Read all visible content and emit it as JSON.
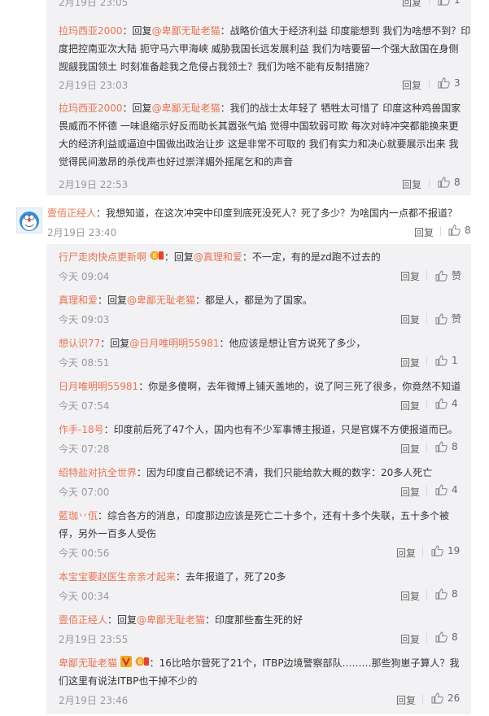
{
  "top_partial": {
    "time": "2月19日 23:05",
    "reply_label": "回复",
    "likes": "1"
  },
  "replies_top": [
    {
      "name": "拉玛西亚2000",
      "prefix": "：回复",
      "at": "@卑鄙无耻老猫",
      "text1": "：战略价值大于经济利益 印度能想到 我们为啥想不到？印",
      "text2": "度把控南亚次大陆 扼守马六甲海峡 威胁我国长远发展利益 我们为啥要留一个强大敌国在身侧",
      "text3": "觊觎我国领土 时刻准备趁我之危侵占我领土？我们为啥不能有反制措施？",
      "time": "2月19日 23:03",
      "reply_label": "回复",
      "likes": "3"
    },
    {
      "name": "拉玛西亚2000",
      "prefix": "：回复",
      "at": "@卑鄙无耻老猫",
      "text1": "：我们的战士太年轻了 牺牲太可惜了 印度这种鸡兽国家",
      "text2": "畏威而不怀德 一味退缩示好反而助长其嚣张气焰 觉得中国软弱可欺 每次对峙冲突都能换来更",
      "text3": "大的经济利益或逼迫中国做出政治让步 这是非常不可取的 我们有实力和决心就要展示出来 我",
      "text4": "觉得民间激昂的杀伐声也好过崇洋媚外摇尾乞和的声音",
      "time": "2月19日 22:53",
      "reply_label": "回复",
      "likes": "8"
    }
  ],
  "main_comment": {
    "name": "壹佰正经人",
    "text": "：我想知道，在这次冲突中印度到底死没死人？死了多少？为啥国内一点都不报道？",
    "time": "2月19日 23:40",
    "reply_label": "回复",
    "likes": "8"
  },
  "replies": [
    {
      "name": "行尸走肉快点更新啊",
      "badge": true,
      "prefix": "：回复",
      "at": "@真理和爱",
      "text": "：不一定，有的是zd跑不过去的",
      "time": "今天 09:04",
      "reply_label": "回复",
      "likes": "赞"
    },
    {
      "name": "真理和爱",
      "prefix": "：回复",
      "at": "@卑鄙无耻老猫",
      "text": "：都是人，都是为了国家。",
      "time": "今天 09:03",
      "reply_label": "回复",
      "likes": "赞"
    },
    {
      "name": "想认识77",
      "prefix": "：回复",
      "at": "@日月唯明明55981",
      "text": "：他应该是想让官方说死了多少，",
      "time": "今天 08:51",
      "reply_label": "回复",
      "likes": "1"
    },
    {
      "name": "日月唯明明55981",
      "text": "：你是多傻啊，去年微博上铺天盖地的，说了阿三死了很多，你竟然不知道",
      "time": "今天 07:54",
      "reply_label": "回复",
      "likes": "4"
    },
    {
      "name": "作手-18号",
      "text": "：印度前后死了47个人，国内也有不少军事博主报道，只是官媒不方便报道而已。",
      "time": "今天 07:28",
      "reply_label": "回复",
      "likes": "8"
    },
    {
      "name": "绍特盐对抗全世界",
      "text": "：因为印度自己都统记不清，我们只能给款大概的数字：20多人死亡",
      "time": "今天 07:00",
      "reply_label": "回复",
      "likes": "4"
    },
    {
      "name": "藍珈丷佤",
      "text": "：综合各方的消息，印度那边应该是死亡二十多个，还有十多个失联，五十多个被",
      "text2": "俘，另外一百多人受伤",
      "time": "今天 00:56",
      "reply_label": "回复",
      "likes": "19"
    },
    {
      "name": "本宝宝要赵医生亲亲才起来",
      "text": "：去年报道了，死了20多",
      "time": "今天 00:34",
      "reply_label": "回复",
      "likes": "8"
    },
    {
      "name": "壹佰正经人",
      "prefix": "：回复",
      "at": "@卑鄙无耻老猫",
      "text": "：印度那些畜生死的好",
      "time": "2月19日 23:55",
      "reply_label": "回复",
      "likes": "8"
    },
    {
      "name": "卑鄙无耻老猫",
      "badge": true,
      "vbadge": true,
      "text": "：16比哈尔营死了21个，ITBP边境警察部队………那些狗崽子算人？我",
      "text2": "们这里有说法ITBP也干掉不少的",
      "time": "2月19日 23:46",
      "reply_label": "回复",
      "likes": "26"
    }
  ]
}
